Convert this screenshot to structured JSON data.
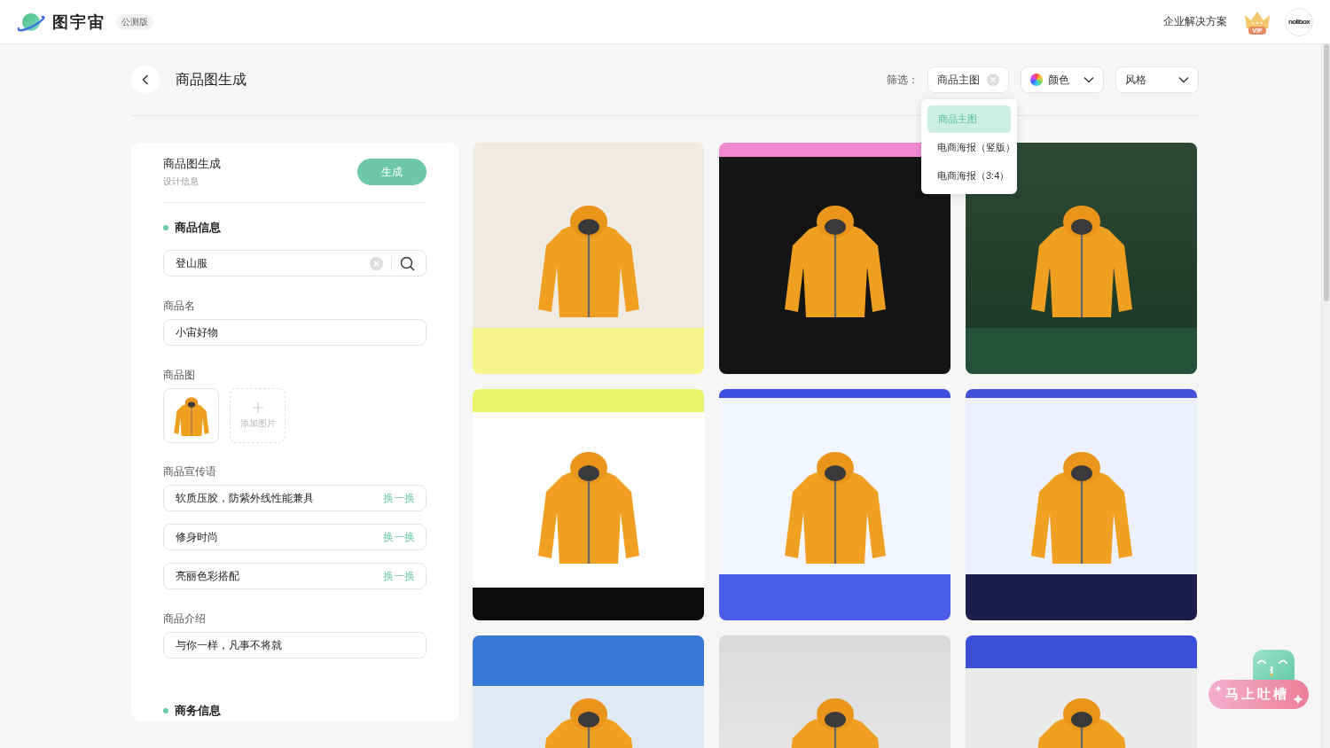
{
  "header": {
    "logo": "图宇宙",
    "badge": "公测版",
    "link": "企业解决方案",
    "vip": "VIP",
    "avatar": "nolibox"
  },
  "page": {
    "title": "商品图生成"
  },
  "filters": {
    "label": "筛选：",
    "chips": [
      {
        "kind": "clearable",
        "label": "商品主图"
      },
      {
        "kind": "color",
        "label": "颜色"
      },
      {
        "kind": "select",
        "label": "风格"
      }
    ],
    "menu": {
      "items": [
        {
          "label": "商品主图",
          "selected": true
        },
        {
          "label": "电商海报（竖版）",
          "selected": false
        },
        {
          "label": "电商海报（3:4）",
          "selected": false
        }
      ]
    }
  },
  "form": {
    "title": "商品图生成",
    "subtitle": "设计信息",
    "action": "生成",
    "sections": [
      {
        "title": "商品信息",
        "fields": [
          {
            "kind": "search",
            "value": "登山服"
          },
          {
            "kind": "text",
            "label": "商品名",
            "value": "小宙好物"
          },
          {
            "kind": "images",
            "label": "商品图",
            "add_label": "添加图片"
          },
          {
            "kind": "slogans",
            "label": "商品宣传语",
            "items": [
              {
                "value": "软质压胶，防紫外线性能兼具",
                "action": "换一换"
              },
              {
                "value": "修身时尚",
                "action": "换一换"
              },
              {
                "value": "亮丽色彩搭配",
                "action": "换一换"
              }
            ]
          },
          {
            "kind": "text",
            "label": "商品介绍",
            "value": "与你一样，凡事不将就"
          }
        ]
      },
      {
        "title": "商务信息"
      }
    ]
  },
  "feedback": {
    "label": "马上吐槽"
  }
}
